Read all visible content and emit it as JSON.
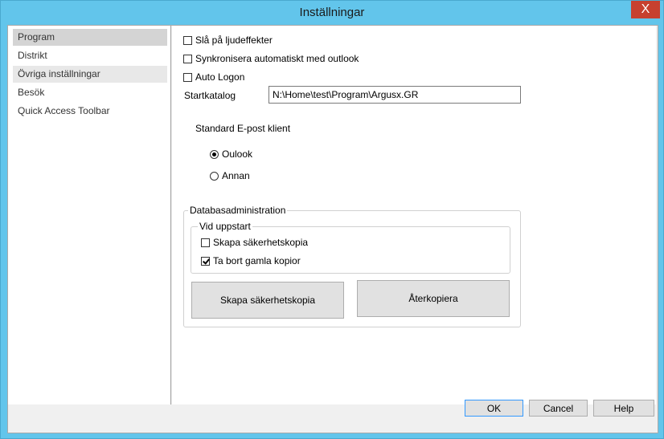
{
  "window": {
    "title": "Inställningar",
    "close_glyph": "X"
  },
  "sidebar": {
    "items": [
      {
        "label": "Program"
      },
      {
        "label": "Distrikt"
      },
      {
        "label": "Övriga inställningar"
      },
      {
        "label": "Besök"
      },
      {
        "label": "Quick Access Toolbar"
      }
    ]
  },
  "settings": {
    "sound_effects": {
      "label": "Slå på ljudeffekter",
      "checked": false
    },
    "sync_outlook": {
      "label": "Synkronisera automatiskt med outlook",
      "checked": false
    },
    "auto_logon": {
      "label": "Auto Logon",
      "checked": false
    },
    "start_dir": {
      "label": "Startkatalog",
      "value": "N:\\Home\\test\\Program\\Argusx.GR"
    }
  },
  "email_client": {
    "label": "Standard E-post klient",
    "options": [
      {
        "label": "Oulook",
        "selected": true
      },
      {
        "label": "Annan",
        "selected": false
      }
    ]
  },
  "database": {
    "title": "Databasadministration",
    "startup": {
      "title": "Vid uppstart",
      "backup": {
        "label": "Skapa säkerhetskopia",
        "checked": false
      },
      "delete_old": {
        "label": "Ta bort gamla kopior",
        "checked": true
      }
    },
    "backup_button": "Skapa säkerhetskopia",
    "restore_button": "Återkopiera"
  },
  "footer": {
    "ok": "OK",
    "cancel": "Cancel",
    "help": "Help"
  }
}
